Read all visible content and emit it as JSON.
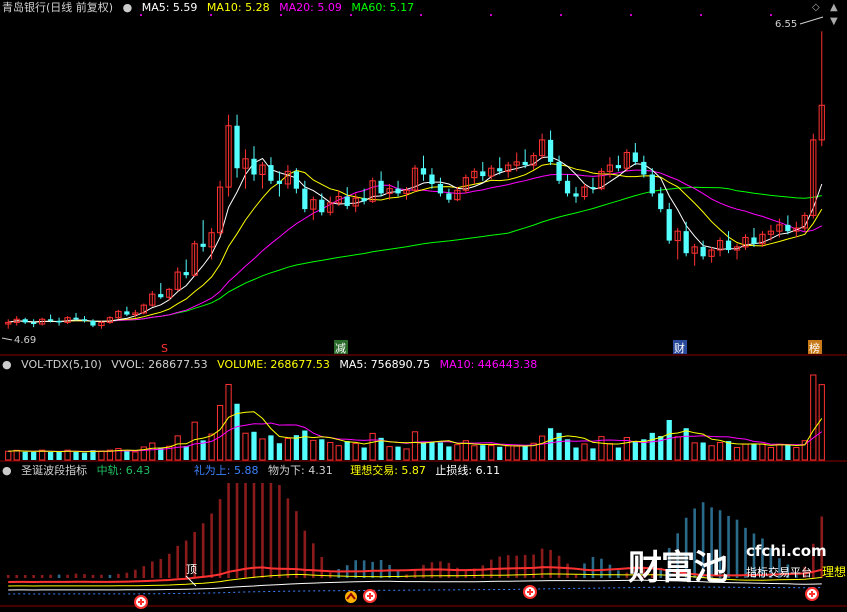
{
  "main_header": {
    "title": "青岛银行(日线 前复权)",
    "ma5": "MA5: 5.59",
    "ma10": "MA10: 5.28",
    "ma20": "MA20: 5.09",
    "ma60": "MA60: 5.17"
  },
  "main_labels": {
    "high_price": "6.55",
    "low_price": "4.69",
    "mark_s": "S",
    "mark_jian": "减",
    "mark_cai": "财",
    "mark_bang": "榜"
  },
  "vol_header": {
    "name": "VOL-TDX(5,10)",
    "vvol": "VVOL: 268677.53",
    "volume": "VOLUME: 268677.53",
    "ma5": "MA5: 756890.75",
    "ma10": "MA10: 446443.38"
  },
  "ind_header": {
    "name": "圣诞波段指标",
    "zhongui": "中轨: 6.43",
    "lishang": "礼为上: 5.88",
    "wuxia": "物为下: 4.31",
    "lixiang": "理想交易: 5.87",
    "zhisun": "止损线: 6.11"
  },
  "ind_labels": {
    "ding": "顶",
    "lixiang_tag": "理想"
  },
  "watermark": {
    "cn": "财富池",
    "url": "cfchi.com",
    "sub": "指标交易平台"
  },
  "colors": {
    "up": "#ff3232",
    "down": "#54ffff",
    "ma5": "#ffffff",
    "ma10": "#ffff00",
    "ma20": "#ff00ff",
    "ma60": "#00ff00"
  },
  "chart_data": {
    "type": "candlestick",
    "title": "青岛银行(日线 前复权)",
    "y_marks": {
      "high": 6.55,
      "low": 4.69
    },
    "candles": [
      [
        4.69,
        4.72,
        4.66,
        4.7
      ],
      [
        4.7,
        4.74,
        4.68,
        4.72
      ],
      [
        4.72,
        4.73,
        4.69,
        4.7
      ],
      [
        4.7,
        4.72,
        4.67,
        4.69
      ],
      [
        4.69,
        4.73,
        4.68,
        4.72
      ],
      [
        4.72,
        4.75,
        4.7,
        4.71
      ],
      [
        4.71,
        4.73,
        4.68,
        4.7
      ],
      [
        4.7,
        4.74,
        4.69,
        4.73
      ],
      [
        4.73,
        4.76,
        4.71,
        4.72
      ],
      [
        4.72,
        4.74,
        4.7,
        4.71
      ],
      [
        4.71,
        4.72,
        4.67,
        4.68
      ],
      [
        4.68,
        4.71,
        4.66,
        4.7
      ],
      [
        4.7,
        4.74,
        4.69,
        4.73
      ],
      [
        4.73,
        4.78,
        4.72,
        4.77
      ],
      [
        4.77,
        4.8,
        4.74,
        4.75
      ],
      [
        4.75,
        4.78,
        4.73,
        4.76
      ],
      [
        4.76,
        4.82,
        4.75,
        4.81
      ],
      [
        4.81,
        4.9,
        4.8,
        4.88
      ],
      [
        4.88,
        4.95,
        4.85,
        4.86
      ],
      [
        4.86,
        4.92,
        4.84,
        4.91
      ],
      [
        4.91,
        5.05,
        4.9,
        5.02
      ],
      [
        5.02,
        5.1,
        4.98,
        5.0
      ],
      [
        5.0,
        5.22,
        4.99,
        5.2
      ],
      [
        5.2,
        5.35,
        5.15,
        5.18
      ],
      [
        5.18,
        5.3,
        5.1,
        5.27
      ],
      [
        5.27,
        5.6,
        5.25,
        5.56
      ],
      [
        5.56,
        6.02,
        5.5,
        5.95
      ],
      [
        5.95,
        6.02,
        5.62,
        5.68
      ],
      [
        5.68,
        5.8,
        5.55,
        5.74
      ],
      [
        5.74,
        5.82,
        5.6,
        5.64
      ],
      [
        5.64,
        5.72,
        5.55,
        5.7
      ],
      [
        5.7,
        5.75,
        5.58,
        5.6
      ],
      [
        5.6,
        5.66,
        5.5,
        5.58
      ],
      [
        5.58,
        5.7,
        5.55,
        5.66
      ],
      [
        5.66,
        5.68,
        5.52,
        5.55
      ],
      [
        5.55,
        5.6,
        5.4,
        5.42
      ],
      [
        5.42,
        5.5,
        5.35,
        5.48
      ],
      [
        5.48,
        5.52,
        5.38,
        5.4
      ],
      [
        5.4,
        5.5,
        5.38,
        5.46
      ],
      [
        5.46,
        5.54,
        5.44,
        5.5
      ],
      [
        5.5,
        5.56,
        5.42,
        5.44
      ],
      [
        5.44,
        5.52,
        5.4,
        5.49
      ],
      [
        5.49,
        5.55,
        5.45,
        5.47
      ],
      [
        5.47,
        5.62,
        5.46,
        5.6
      ],
      [
        5.6,
        5.66,
        5.5,
        5.52
      ],
      [
        5.52,
        5.58,
        5.48,
        5.55
      ],
      [
        5.55,
        5.6,
        5.5,
        5.52
      ],
      [
        5.52,
        5.56,
        5.48,
        5.54
      ],
      [
        5.54,
        5.7,
        5.53,
        5.68
      ],
      [
        5.68,
        5.76,
        5.6,
        5.64
      ],
      [
        5.64,
        5.68,
        5.55,
        5.58
      ],
      [
        5.58,
        5.62,
        5.5,
        5.52
      ],
      [
        5.52,
        5.55,
        5.46,
        5.48
      ],
      [
        5.48,
        5.56,
        5.47,
        5.54
      ],
      [
        5.54,
        5.64,
        5.52,
        5.62
      ],
      [
        5.62,
        5.68,
        5.58,
        5.66
      ],
      [
        5.66,
        5.72,
        5.6,
        5.63
      ],
      [
        5.63,
        5.7,
        5.61,
        5.68
      ],
      [
        5.68,
        5.75,
        5.64,
        5.66
      ],
      [
        5.66,
        5.72,
        5.62,
        5.7
      ],
      [
        5.7,
        5.78,
        5.66,
        5.72
      ],
      [
        5.72,
        5.8,
        5.68,
        5.7
      ],
      [
        5.7,
        5.78,
        5.67,
        5.76
      ],
      [
        5.76,
        5.9,
        5.74,
        5.86
      ],
      [
        5.86,
        5.92,
        5.7,
        5.72
      ],
      [
        5.72,
        5.76,
        5.58,
        5.6
      ],
      [
        5.6,
        5.64,
        5.5,
        5.52
      ],
      [
        5.52,
        5.56,
        5.46,
        5.5
      ],
      [
        5.5,
        5.58,
        5.48,
        5.56
      ],
      [
        5.56,
        5.62,
        5.52,
        5.55
      ],
      [
        5.55,
        5.68,
        5.54,
        5.66
      ],
      [
        5.66,
        5.75,
        5.62,
        5.7
      ],
      [
        5.7,
        5.76,
        5.66,
        5.68
      ],
      [
        5.68,
        5.8,
        5.66,
        5.78
      ],
      [
        5.78,
        5.84,
        5.7,
        5.72
      ],
      [
        5.72,
        5.76,
        5.62,
        5.64
      ],
      [
        5.64,
        5.68,
        5.5,
        5.52
      ],
      [
        5.52,
        5.56,
        5.4,
        5.42
      ],
      [
        5.42,
        5.46,
        5.2,
        5.22
      ],
      [
        5.22,
        5.3,
        5.1,
        5.28
      ],
      [
        5.28,
        5.34,
        5.12,
        5.14
      ],
      [
        5.14,
        5.2,
        5.06,
        5.18
      ],
      [
        5.18,
        5.22,
        5.1,
        5.12
      ],
      [
        5.12,
        5.18,
        5.08,
        5.16
      ],
      [
        5.16,
        5.24,
        5.12,
        5.22
      ],
      [
        5.22,
        5.28,
        5.14,
        5.16
      ],
      [
        5.16,
        5.2,
        5.1,
        5.18
      ],
      [
        5.18,
        5.26,
        5.16,
        5.24
      ],
      [
        5.24,
        5.3,
        5.18,
        5.2
      ],
      [
        5.2,
        5.28,
        5.18,
        5.26
      ],
      [
        5.26,
        5.32,
        5.22,
        5.28
      ],
      [
        5.28,
        5.36,
        5.24,
        5.32
      ],
      [
        5.32,
        5.38,
        5.26,
        5.28
      ],
      [
        5.28,
        5.34,
        5.24,
        5.3
      ],
      [
        5.3,
        5.4,
        5.28,
        5.38
      ],
      [
        5.38,
        5.9,
        5.36,
        5.86
      ],
      [
        5.86,
        6.55,
        5.82,
        6.08
      ]
    ]
  }
}
